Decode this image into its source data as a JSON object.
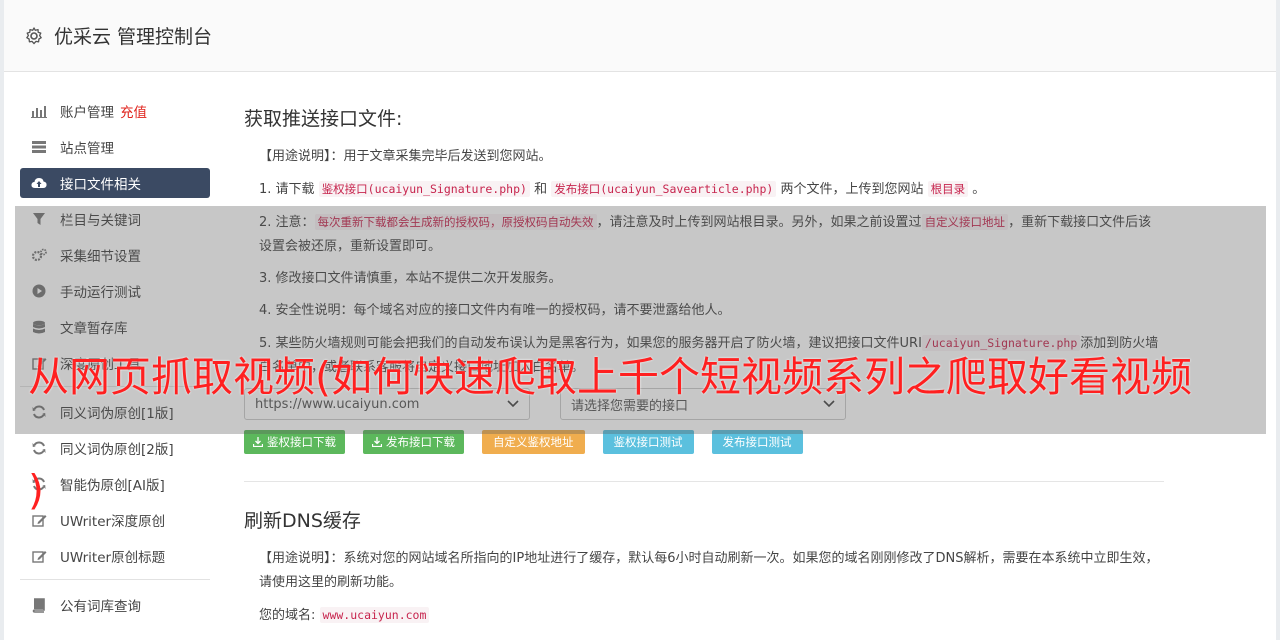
{
  "header": {
    "title": "优采云 管理控制台"
  },
  "sidebar": {
    "items": [
      {
        "label": "账户管理",
        "badge": "充值",
        "icon": "bar-chart-icon"
      },
      {
        "label": "站点管理",
        "icon": "server-icon"
      },
      {
        "label": "接口文件相关",
        "icon": "cloud-upload-icon"
      },
      {
        "label": "栏目与关键词",
        "icon": "filter-icon"
      },
      {
        "label": "采集细节设置",
        "icon": "cogs-icon"
      },
      {
        "label": "手动运行测试",
        "icon": "play-icon"
      },
      {
        "label": "文章暂存库",
        "icon": "database-icon"
      },
      {
        "label": "深度原创工具",
        "icon": "edit-icon"
      },
      {
        "label": "同义词伪原创[1版]",
        "icon": "refresh-icon"
      },
      {
        "label": "同义词伪原创[2版]",
        "icon": "refresh-icon"
      },
      {
        "label": "智能伪原创[AI版]",
        "icon": "refresh-icon"
      },
      {
        "label": "UWriter深度原创",
        "icon": "edit-icon"
      },
      {
        "label": "UWriter原创标题",
        "icon": "edit-icon"
      },
      {
        "label": "公有词库查询",
        "icon": "book-icon"
      }
    ]
  },
  "section1": {
    "title": "获取推送接口文件:",
    "usage_label": "【用途说明】",
    "usage_text": "：用于文章采集完毕后发送到您网站。",
    "step1_a": "1. 请下载",
    "step1_code1": "鉴权接口(ucaiyun_Signature.php)",
    "step1_b": "和",
    "step1_code2": "发布接口(ucaiyun_Savearticle.php)",
    "step1_c": "两个文件，上传到您网站",
    "step1_code3": "根目录",
    "step1_d": "。",
    "step2_a": "2. 注意：",
    "step2_code1": "每次重新下载都会生成新的授权码，原授权码自动失效",
    "step2_b": "，请注意及时上传到网站根目录。另外，如果之前设置过",
    "step2_code2": "自定义接口地址",
    "step2_c": "，重新下载接口文件后该设置会被还原，重新设置即可。",
    "step3": "3. 修改接口文件请慎重，本站不提供二次开发服务。",
    "step4": "4. 安全性说明：每个域名对应的接口文件内有唯一的授权码，请不要泄露给他人。",
    "step5_a": "5. 某些防火墙规则可能会把我们的自动发布误认为是黑客行为，如果您的服务器开启了防火墙，建议把接口文件URI",
    "step5_code": "/ucaiyun_Signature.php",
    "step5_b": "添加到防火墙白名单中，或者联系客服将自定义接口地址加入白名单。",
    "site_select": "https://www.ucaiyun.com",
    "api_select": "请选择您需要的接口",
    "btn_auth_download": "鉴权接口下载",
    "btn_publish_download": "发布接口下载",
    "btn_custom_auth": "自定义鉴权地址",
    "btn_auth_test": "鉴权接口测试",
    "btn_publish_test": "发布接口测试"
  },
  "section2": {
    "title": "刷新DNS缓存",
    "usage_label": "【用途说明】",
    "usage_text": "：系统对您的网站域名所指向的IP地址进行了缓存，默认每6小时自动刷新一次。如果您的域名刚刚修改了DNS解析，需要在本系统中立即生效，请使用这里的刷新功能。",
    "domain_label": "您的域名:",
    "domain_value": "www.ucaiyun.com"
  },
  "overlay": {
    "banner": "从网页抓取视频(如何快速爬取上千个短视频系列之爬取好看视频",
    "banner_tail": ")"
  },
  "colors": {
    "active_nav": "#3b4a63",
    "green": "#5cb85c",
    "orange": "#f0ad4e",
    "blue": "#5bc0de",
    "banner_red": "#ff2020"
  }
}
